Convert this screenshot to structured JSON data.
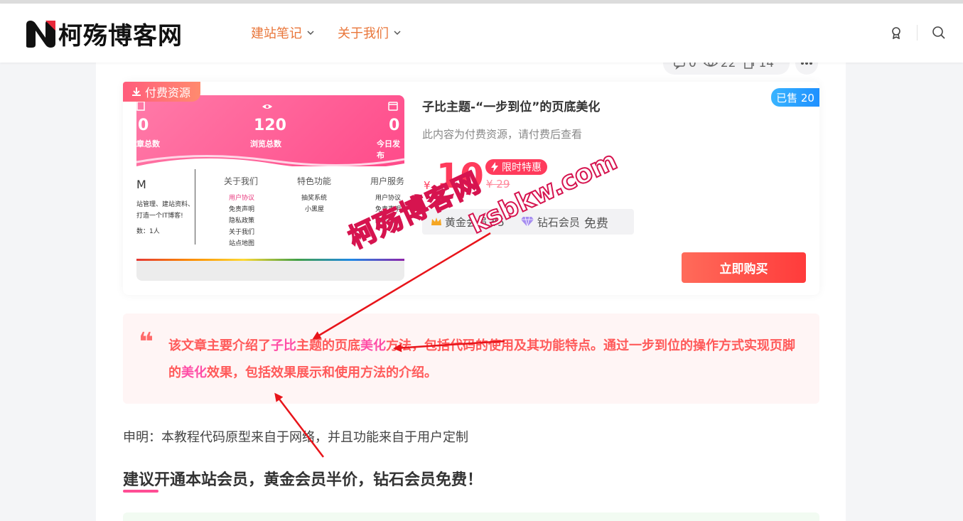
{
  "header": {
    "logo_text": "柯殇博客网",
    "nav": [
      {
        "label": "建站笔记"
      },
      {
        "label": "关于我们"
      }
    ]
  },
  "stats": {
    "comments": "0",
    "views": "22",
    "favorites": "14"
  },
  "pay": {
    "ribbon": "付费资源",
    "sold": "已售 20",
    "title": "子比主题-“一步到位”的页底美化",
    "desc": "此内容为付费资源，请付费后查看",
    "currency": "¥",
    "price": "10",
    "limit_label": "限时特惠",
    "orig_price": "¥ 29",
    "vip_gold": "黄金会员 ¥5",
    "vip_diamond": "钻石会员",
    "vip_diamond_price": "免费",
    "buy_label": "立即购买"
  },
  "thumb": {
    "num_left": "0",
    "num_mid": "120",
    "num_right": "0",
    "lbl_left": "章总数",
    "lbl_mid": "浏览总数",
    "lbl_right": "今日发布",
    "left_big": "M",
    "left_lines": [
      "站管理、建站资料、",
      "打造一个IT博客!",
      "数：1人"
    ],
    "cols": [
      {
        "head": "关于我们",
        "links": [
          "用户协议",
          "免责声明",
          "隐私政策",
          "关于我们",
          "站点地图"
        ]
      },
      {
        "head": "特色功能",
        "links": [
          "抽奖系统",
          "小黑屋"
        ]
      },
      {
        "head": "用户服务",
        "links": [
          "用户协议",
          "免责声明",
          "隐私政策"
        ]
      }
    ]
  },
  "quote": {
    "p1": "该文章主要介绍了",
    "h1": "子比",
    "p2": "主题的页底",
    "h2": "美化",
    "p3": "方法，包括代码的使用及其功能特点。通过一步到位的操作方式实现页脚的",
    "h3": "美化",
    "p4": "效果，包括效果展示和使用方法的介绍。"
  },
  "declare": "申明：本教程代码原型来自于网络，并且功能来自于用户定制",
  "advice": "建议开通本站会员，黄金会员半价，钻石会员免费！",
  "watermark": {
    "cn": "柯殇博客网",
    "en": "ksbkw.com"
  },
  "colors": {
    "accent": "#ff3b5c",
    "nav": "#e9763a",
    "quote": "#ff5a5a",
    "highlight": "#ff4da6"
  }
}
